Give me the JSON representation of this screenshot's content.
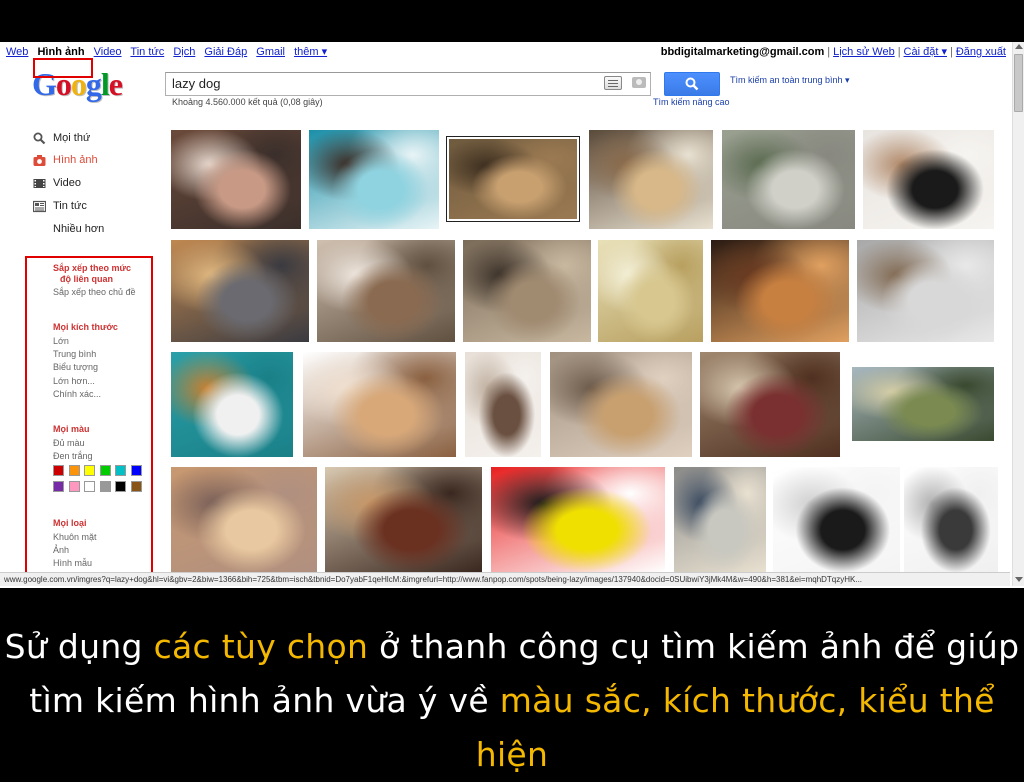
{
  "top_nav": {
    "items": [
      "Web",
      "Hình ảnh",
      "Video",
      "Tin tức",
      "Dịch",
      "Giải Đáp",
      "Gmail",
      "thêm ▾"
    ],
    "active_index": 1
  },
  "account": {
    "email": "bbdigitalmarketing@gmail.com",
    "history": "Lịch sử Web",
    "settings": "Cài đặt ▾",
    "logout": "Đăng xuất"
  },
  "logo": {
    "text": "Google",
    "letter_colors": [
      "#3369e8",
      "#d50f25",
      "#eeb211",
      "#3369e8",
      "#009925",
      "#d50f25"
    ]
  },
  "search": {
    "query": "lazy dog",
    "result_stats": "Khoảng 4.560.000 kết quả (0,08 giây)",
    "safe_search": "Tìm kiếm an toàn trung bình ▾",
    "advanced": "Tìm kiếm nâng cao",
    "button_color": "#4d90fe"
  },
  "sidebar": {
    "nav": [
      {
        "label": "Mọi thứ",
        "icon": "magnifier-icon"
      },
      {
        "label": "Hình ảnh",
        "icon": "camera-icon"
      },
      {
        "label": "Video",
        "icon": "film-icon"
      },
      {
        "label": "Tin tức",
        "icon": "newspaper-icon"
      },
      {
        "label": "Nhiều hơn",
        "icon": ""
      }
    ],
    "sort": {
      "heading_line1": "Sắp xếp theo mức",
      "heading_line2": "độ liên quan",
      "option": "Sắp xếp theo chủ đề"
    },
    "size": {
      "heading": "Mọi kích thước",
      "options": [
        "Lớn",
        "Trung bình",
        "Biểu tượng",
        "Lớn hơn...",
        "Chính xác..."
      ]
    },
    "color": {
      "heading": "Mọi màu",
      "options": [
        "Đủ màu",
        "Đen trắng"
      ],
      "swatches": [
        "#cc0000",
        "#fb940b",
        "#ffff00",
        "#00cc00",
        "#03c0c6",
        "#0000ff",
        "#762ca7",
        "#ff98bf",
        "#ffffff",
        "#999999",
        "#000000",
        "#885418"
      ]
    },
    "type": {
      "heading": "Mọi loại",
      "options": [
        "Khuôn mặt",
        "Ảnh",
        "Hình mẫu"
      ]
    }
  },
  "status_url": "www.google.com.vn/imgres?q=lazy+dog&hl=vi&gbv=2&biw=1366&bih=725&tbm=isch&tbnid=Do7yabF1qeHlcM:&imgrefurl=http://www.fanpop.com/spots/being-lazy/images/137940&docid=0SUibwiY3jMk4M&w=490&h=381&ei=mqhDTqzyHK...",
  "thumbnails": [
    {
      "name": "dog-lounge-chair",
      "colors": [
        "#6b4a3a",
        "#c89a86",
        "#e8d9cf",
        "#3b2f2b"
      ]
    },
    {
      "name": "dog-pool-float",
      "colors": [
        "#1b8fa8",
        "#8fd3e0",
        "#3a2a22",
        "#e8f4f6"
      ]
    },
    {
      "name": "dog-sleeping-floor",
      "colors": [
        "#6e5a3e",
        "#c8a070",
        "#3a2c1e",
        "#9b7a52"
      ]
    },
    {
      "name": "fat-dog-lying",
      "colors": [
        "#5a4a3a",
        "#d8b888",
        "#8a6a4a",
        "#e8e0d0"
      ]
    },
    {
      "name": "dog-walked-by-car",
      "colors": [
        "#9aa090",
        "#d0d0c8",
        "#5a6a50",
        "#888880"
      ]
    },
    {
      "name": "puppy-black-white",
      "colors": [
        "#e8e4e0",
        "#1a1a1a",
        "#b08868",
        "#f6f4f0"
      ]
    },
    {
      "name": "dog-on-couch-arm",
      "colors": [
        "#c08850",
        "#6a6a70",
        "#e0b880",
        "#3a3a40"
      ]
    },
    {
      "name": "dog-curled-chair",
      "colors": [
        "#d0c0b0",
        "#8a6a50",
        "#f0e8e0",
        "#605040"
      ]
    },
    {
      "name": "dogs-wooden-floor",
      "colors": [
        "#7a6a58",
        "#a08a70",
        "#3a3028",
        "#c8b8a0"
      ]
    },
    {
      "name": "dog-hammock-cartoon",
      "colors": [
        "#e8e0b8",
        "#d8c890",
        "#f4f0d8",
        "#b8a060"
      ]
    },
    {
      "name": "dog-chin-floor",
      "colors": [
        "#2a1a12",
        "#c88040",
        "#6a3a20",
        "#e0a060"
      ]
    },
    {
      "name": "dog-sprawled-road",
      "colors": [
        "#a8a8a8",
        "#d8d8d8",
        "#806850",
        "#e8e8e8"
      ]
    },
    {
      "name": "plush-dogs",
      "colors": [
        "#2aa0a8",
        "#f0f0f0",
        "#c88030",
        "#1a8088"
      ]
    },
    {
      "name": "bulldog-lying",
      "colors": [
        "#ffffff",
        "#d8a878",
        "#f0e0d0",
        "#8a6040"
      ]
    },
    {
      "name": "dog-bottle",
      "colors": [
        "#e8e0d8",
        "#6a5040",
        "#c0b0a0",
        "#f4f0ec"
      ]
    },
    {
      "name": "dog-resting-head",
      "colors": [
        "#a09080",
        "#c8a070",
        "#6a5848",
        "#e0d0c0"
      ]
    },
    {
      "name": "dog-on-bed",
      "colors": [
        "#a08870",
        "#7a3030",
        "#d8c8b0",
        "#503020"
      ]
    },
    {
      "name": "dog-balloons-field",
      "colors": [
        "#a8b8c0",
        "#7a8a50",
        "#d8d0a8",
        "#3a4a30"
      ]
    },
    {
      "name": "dog-beach-sunset",
      "colors": [
        "#c89870",
        "#e8c8a0",
        "#7a6058",
        "#b09080"
      ]
    },
    {
      "name": "bulldog-by-door",
      "colors": [
        "#d8c8b0",
        "#6a3020",
        "#c89868",
        "#3a2820"
      ]
    },
    {
      "name": "yellow-dog-cartoon",
      "colors": [
        "#e82020",
        "#f0e000",
        "#1a1a1a",
        "#ffffff"
      ]
    },
    {
      "name": "dog-street-people",
      "colors": [
        "#8a8a88",
        "#c8c8c0",
        "#3a4a60",
        "#e8e0d0"
      ]
    },
    {
      "name": "dog-leash-cartoon",
      "colors": [
        "#ffffff",
        "#1a1a1a",
        "#d0d0d0",
        "#f4f4f4"
      ]
    },
    {
      "name": "sketch-shoes",
      "colors": [
        "#ffffff",
        "#3a3a3a",
        "#b0b0b0",
        "#f0f0f0"
      ]
    }
  ],
  "caption": {
    "line1_a": "Sử dụng ",
    "line1_b": "các tùy chọn",
    "line1_c": " ở thanh công cụ tìm kiếm ảnh để giúp",
    "line2_a": "tìm kiếm hình ảnh vừa ý về ",
    "line2_b": "màu sắc, kích thước, kiểu thể hiện",
    "highlight_color": "#f5b800"
  }
}
